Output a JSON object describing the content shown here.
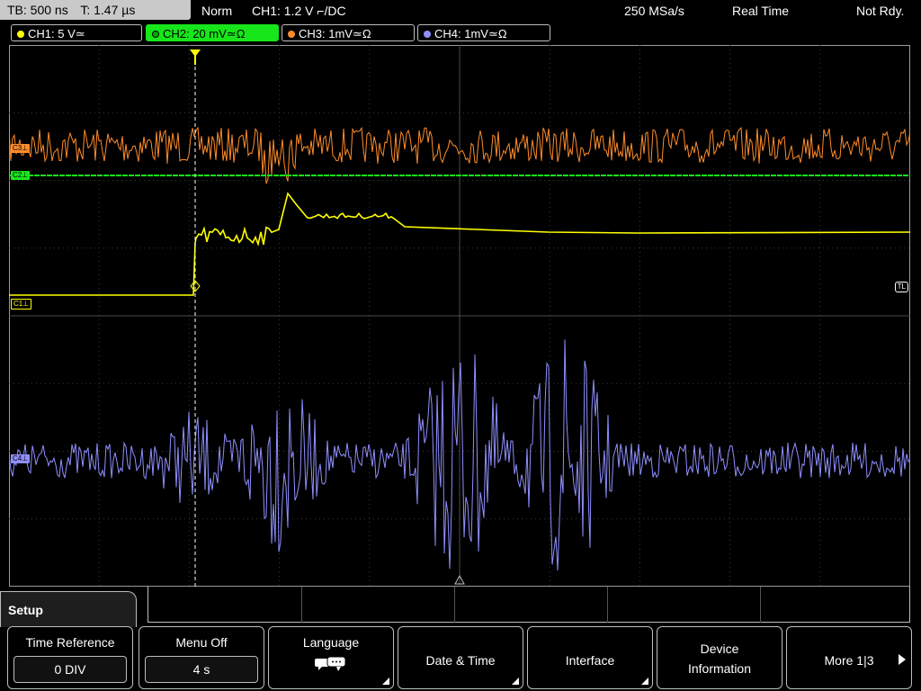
{
  "topbar": {
    "timebase": "TB: 500 ns",
    "trigger_time": "T: 1.47 µs",
    "mode": "Norm",
    "trigger": "CH1: 1.2 V ⌐/DC",
    "sample_rate": "250 MSa/s",
    "acquisition": "Real Time",
    "status": "Not Rdy."
  },
  "channels": [
    {
      "label": "CH1: 5 V≃",
      "color": "#ffff00"
    },
    {
      "label": "CH2: 20 mV≃Ω",
      "color": "#17e61a"
    },
    {
      "label": "CH3: 1mV≃Ω",
      "color": "#ff8c2a"
    },
    {
      "label": "CH4: 1mV≃Ω",
      "color": "#8f8fff"
    }
  ],
  "markers": {
    "c1": "C1⊥",
    "c2": "C2⊥",
    "c3": "C3⊥",
    "c4": "C4⊥",
    "trigger_level": "TL"
  },
  "menu": {
    "title": "Setup",
    "softkeys": {
      "time_reference": {
        "label": "Time Reference",
        "value": "0 DIV"
      },
      "menu_off": {
        "label": "Menu Off",
        "value": "4 s"
      },
      "language": {
        "label": "Language"
      },
      "date_time": {
        "label": "Date & Time"
      },
      "interface": {
        "label": "Interface"
      },
      "device_information": {
        "line1": "Device",
        "line2": "Information"
      },
      "more": {
        "label": "More 1|3"
      }
    }
  },
  "colors": {
    "ch1": "#ffff00",
    "ch2": "#17e61a",
    "ch3": "#ff8c2a",
    "ch4": "#8f8fff",
    "active_tab": "#17e61a"
  }
}
